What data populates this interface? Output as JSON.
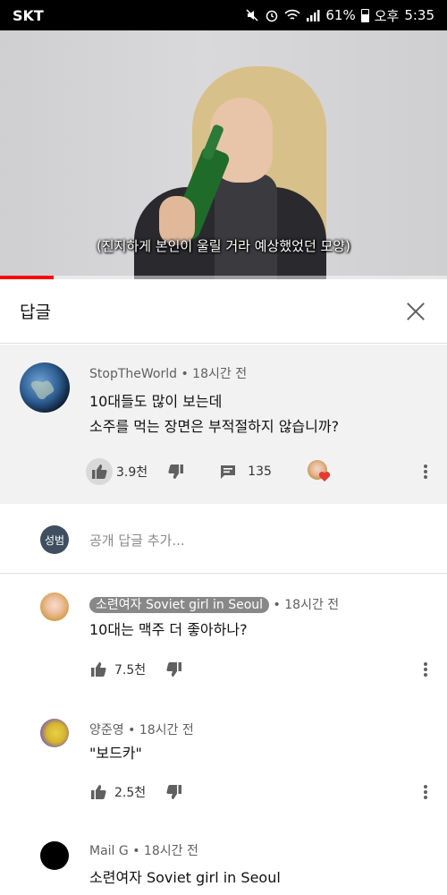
{
  "status_bar": {
    "carrier": "SKT",
    "battery": "61%",
    "ampm": "오후",
    "time": "5:35"
  },
  "video": {
    "subtitle": "(진지하게 본인이 울릴 거라 예상했었던 모양)",
    "progress": 0.12
  },
  "panel": {
    "title": "답글"
  },
  "parent_comment": {
    "author": "StopTheWorld",
    "time": "18시간 전",
    "lines": [
      "10대들도 많이 보는데",
      "소주를 먹는 장면은 부적절하지 않습니까?"
    ],
    "likes": "3.9천",
    "replies": "135"
  },
  "reply_input": {
    "avatar_text": "성범",
    "placeholder": "공개 답글 추가..."
  },
  "replies": [
    {
      "author": "소련여자 Soviet girl in Seoul",
      "time": "18시간 전",
      "text": "10대는 맥주 더 좋아하나?",
      "likes": "7.5천"
    },
    {
      "author": "양준영",
      "time": "18시간 전",
      "text": "\"보드카\"",
      "likes": "2.5천"
    },
    {
      "author": "Mail G",
      "time": "18시간 전",
      "text": "소련여자 Soviet girl in Seoul"
    }
  ],
  "separator": "•",
  "colors": {
    "accent": "#ff0000",
    "heart": "#e53935",
    "chip": "#888888"
  }
}
